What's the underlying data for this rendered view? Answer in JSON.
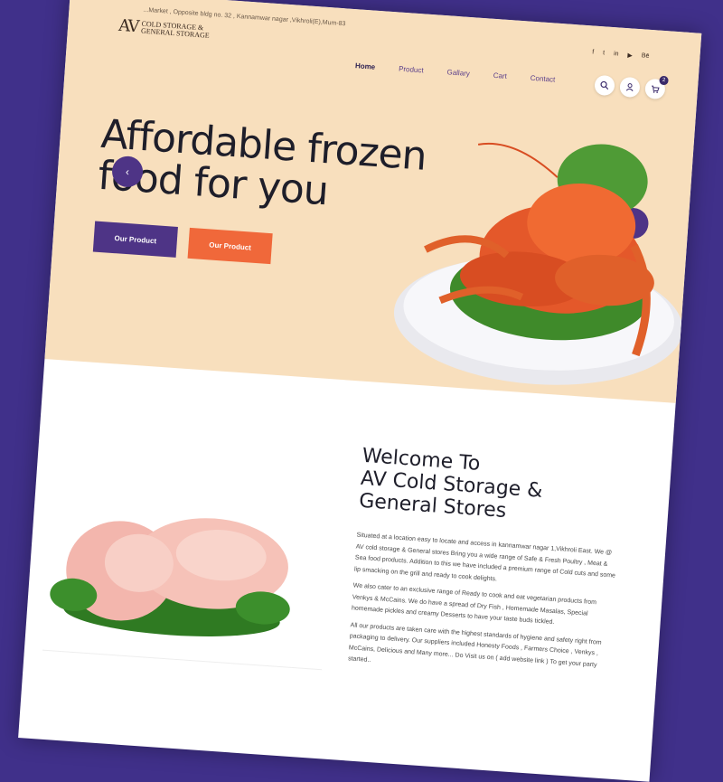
{
  "topbar": {
    "address": "...Market , Opposite bldg no. 32 , Kannamwar nagar ,Vikhroli(E),Mum-83"
  },
  "brand": {
    "mark": "AV",
    "line1": "COLD STORAGE &",
    "line2": "GENERAL STORAGE"
  },
  "socials": [
    {
      "icon": "facebook-icon",
      "glyph": "f"
    },
    {
      "icon": "twitter-icon",
      "glyph": "t"
    },
    {
      "icon": "linkedin-icon",
      "glyph": "in"
    },
    {
      "icon": "youtube-icon",
      "glyph": "▶"
    },
    {
      "icon": "behance-icon",
      "glyph": "Bē"
    }
  ],
  "nav": {
    "items": [
      {
        "label": "Home",
        "active": true
      },
      {
        "label": "Product"
      },
      {
        "label": "Gallary"
      },
      {
        "label": "Cart"
      },
      {
        "label": "Contact"
      }
    ]
  },
  "header_icons": {
    "search": "search-icon",
    "user": "user-icon",
    "cart": "cart-icon",
    "cart_count": "2"
  },
  "hero": {
    "headline_line1": "Affordable frozen",
    "headline_line2": "food for you",
    "primary_button": "Our Product",
    "secondary_button": "Our Product",
    "prev_arrow": "‹",
    "next_arrow": "›"
  },
  "welcome": {
    "title_line1": "Welcome To",
    "title_line2": "AV Cold Storage &",
    "title_line3": "General Stores",
    "paragraphs": [
      "Situated at a location easy to locate and access in kannamwar nagar 1,Vikhroli East. We @ AV cold storage & General stores Bring you a wide range of Safe & Fresh Poultry , Meat & Sea food products. Addition to this we have included a premium range of Cold cuts and some lip smacking on the grill and ready to cook delights.",
      "We also cater to an exclusive range of Ready to cook and eat vegetarian products from Venkys & McCains. We do have a spread of Dry Fish , Homemade Masalas, Special homemade pickles and creamy Desserts to have your taste buds tickled.",
      "All our products are taken care with the highest standards of hygiene and safety right from packaging to delivery. Our suppliers included Honesty Foods , Farmers Choice , Venkys , McCains, Delicious and Many more... Do Visit us on ( add website link ) To get your party started.."
    ]
  },
  "colors": {
    "hero_bg": "#f8dfbd",
    "purple": "#4e3486",
    "orange": "#f0683a",
    "frame": "#40308a"
  }
}
